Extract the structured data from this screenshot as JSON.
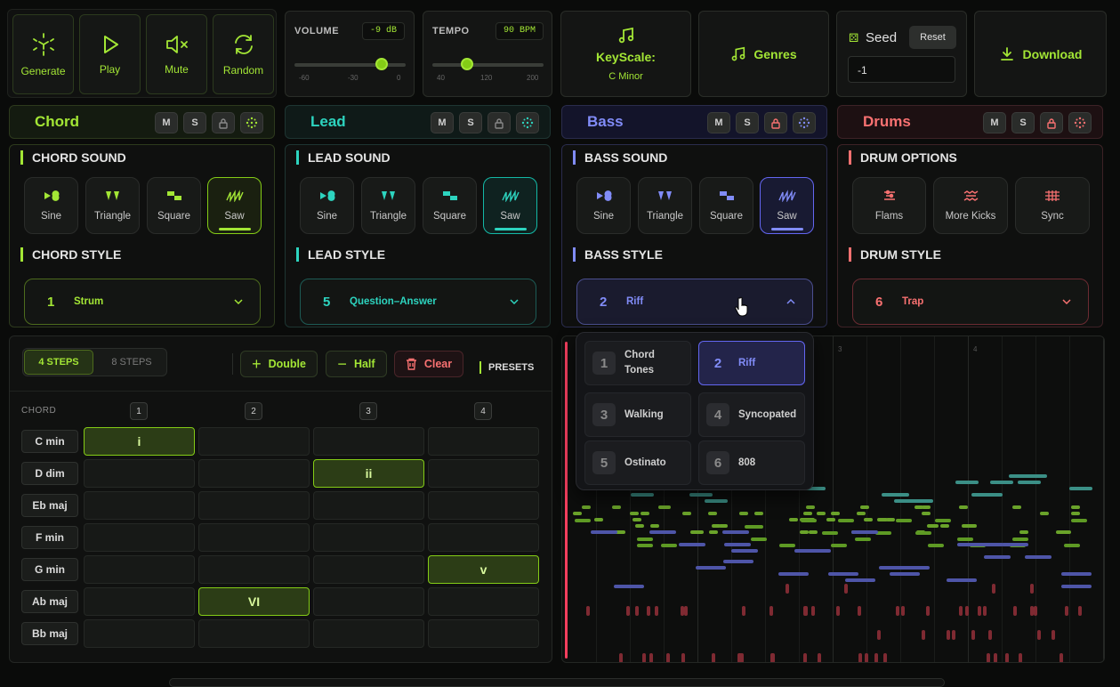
{
  "toolbar": {
    "generate": "Generate",
    "play": "Play",
    "mute": "Mute",
    "random": "Random"
  },
  "volume": {
    "label": "VOLUME",
    "value": "-9 dB",
    "ticks": [
      "-60",
      "-30",
      "0"
    ],
    "level": 0.78
  },
  "tempo": {
    "label": "TEMPO",
    "value": "90 BPM",
    "ticks": [
      "40",
      "120",
      "200"
    ],
    "level": 0.31
  },
  "keyscale": {
    "label": "KeyScale:",
    "value": "C Minor"
  },
  "genres": {
    "label": "Genres"
  },
  "seed": {
    "label": "Seed",
    "reset": "Reset",
    "value": "-1"
  },
  "download": {
    "label": "Download"
  },
  "tracks": {
    "chord": {
      "name": "Chord",
      "m": "M",
      "s": "S",
      "sound_title": "CHORD SOUND",
      "style_title": "CHORD STYLE",
      "style_num": "1",
      "style_name": "Strum",
      "color": "#a3e635"
    },
    "lead": {
      "name": "Lead",
      "m": "M",
      "s": "S",
      "sound_title": "LEAD SOUND",
      "style_title": "LEAD STYLE",
      "style_num": "5",
      "style_name": "Question–Answer",
      "color": "#2dd4bf"
    },
    "bass": {
      "name": "Bass",
      "m": "M",
      "s": "S",
      "sound_title": "BASS SOUND",
      "style_title": "BASS STYLE",
      "style_num": "2",
      "style_name": "Riff",
      "color": "#818cf8"
    },
    "drums": {
      "name": "Drums",
      "m": "M",
      "s": "S",
      "sound_title": "DRUM OPTIONS",
      "style_title": "DRUM STYLE",
      "style_num": "6",
      "style_name": "Trap",
      "color": "#f87171"
    }
  },
  "waves": [
    "Sine",
    "Triangle",
    "Square",
    "Saw"
  ],
  "drum_options": [
    "Flams",
    "More Kicks",
    "Sync"
  ],
  "bass_dropdown": [
    {
      "num": "1",
      "label": "Chord Tones"
    },
    {
      "num": "2",
      "label": "Riff"
    },
    {
      "num": "3",
      "label": "Walking"
    },
    {
      "num": "4",
      "label": "Syncopated"
    },
    {
      "num": "5",
      "label": "Ostinato"
    },
    {
      "num": "6",
      "label": "808"
    }
  ],
  "sequencer": {
    "steps4": "4 STEPS",
    "steps8": "8 STEPS",
    "double": "Double",
    "half": "Half",
    "clear": "Clear",
    "presets": "PRESETS",
    "chord_label": "CHORD",
    "cols": [
      "1",
      "2",
      "3",
      "4"
    ],
    "rows": [
      "C min",
      "D dim",
      "Eb maj",
      "F min",
      "G min",
      "Ab maj",
      "Bb maj"
    ],
    "active": [
      {
        "row": 0,
        "col": 0,
        "label": "i"
      },
      {
        "row": 1,
        "col": 2,
        "label": "ii"
      },
      {
        "row": 4,
        "col": 3,
        "label": "v"
      },
      {
        "row": 5,
        "col": 1,
        "label": "VI"
      }
    ]
  },
  "roll": {
    "markers": [
      "3",
      "4"
    ]
  },
  "colors": {
    "chord": "#a3e635",
    "lead": "#2dd4bf",
    "bass": "#818cf8",
    "drums": "#f87171",
    "bg": "#0a0b0a"
  }
}
